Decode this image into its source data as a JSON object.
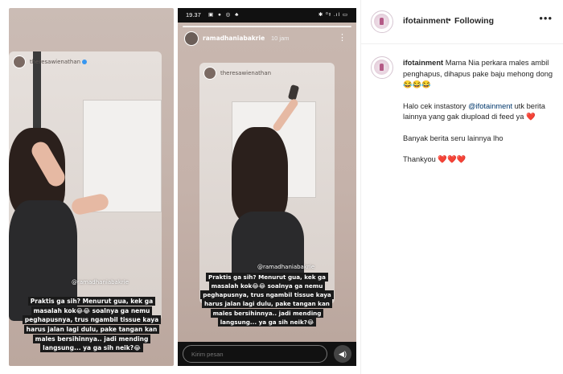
{
  "left_repost": {
    "username": "theresawienathan",
    "mention_tag": "@ramadhaniabakrie",
    "caption_lines": [
      "Praktis ga sih? Menurut gua, kek ga",
      "masalah kok😂😂 soalnya ga nemu",
      "peghapusnya, trus ngambil tissue kaya",
      "harus jalan lagi dulu, pake tangan kan",
      "males bersihinnya.. jadi mending",
      "langsung... ya ga sih neik?😂"
    ]
  },
  "story": {
    "status_time": "19.37",
    "status_icons": "▣ ● ◎ ♣",
    "status_right": "✱ ⁰ᵍ .ıl ▭",
    "username": "ramadhaniabakrie",
    "time_ago": "10 jam",
    "more_icon": "⋮",
    "repost_username": "theresawienathan",
    "mention_tag": "@ramadhaniabakrie",
    "caption_lines": [
      "Praktis ga sih? Menurut gua, kek ga",
      "masalah kok😂😂 soalnya ga nemu",
      "peghapusnya, trus ngambil tissue kaya",
      "harus jalan lagi dulu, pake tangan kan",
      "males bersihinnya.. jadi mending",
      "langsung... ya ga sih neik?😂"
    ],
    "reply_placeholder": "Kirim pesan",
    "send_icon": "speaker-icon"
  },
  "sidebar": {
    "account": "ifotainment",
    "separator": "•",
    "follow_status": "Following",
    "more_icon": "•••",
    "caption": {
      "username": "ifotainment",
      "p1": "Mama Nia perkara males ambil penghapus, dihapus pake baju mehong dong 😂😂😂",
      "p2_before": "Halo cek instastory ",
      "p2_mention": "@ifotainment",
      "p2_after": " utk berita lainnya yang gak diupload di feed ya ❤️",
      "p3": "Banyak berita seru lainnya lho",
      "p4": "Thankyou ❤️❤️❤️"
    }
  }
}
